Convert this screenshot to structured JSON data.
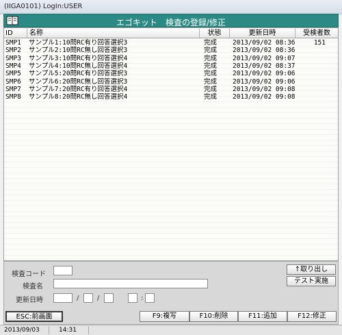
{
  "window": {
    "title": "(IIGA0101)  LogIn:USER"
  },
  "header": {
    "title": "エゴキット　検査の登録/修正",
    "icon": "book-icon"
  },
  "table": {
    "columns": [
      "ID",
      "名称",
      "状態",
      "更新日時",
      "受検者数"
    ],
    "rows": [
      {
        "id": "SMP1",
        "name": "サンプル1:10問RC有り回答選択3",
        "status": "完成",
        "updated": "2013/09/02 08:36",
        "count": "151"
      },
      {
        "id": "SMP2",
        "name": "サンプル2:10問RC無し回答選択3",
        "status": "完成",
        "updated": "2013/09/02 08:36",
        "count": ""
      },
      {
        "id": "SMP3",
        "name": "サンプル3:10問RC有り回答選択4",
        "status": "完成",
        "updated": "2013/09/02 09:07",
        "count": ""
      },
      {
        "id": "SMP4",
        "name": "サンプル4:10問RC無し回答選択4",
        "status": "完成",
        "updated": "2013/09/02 08:37",
        "count": ""
      },
      {
        "id": "SMP5",
        "name": "サンプル5:20問RC有り回答選択3",
        "status": "完成",
        "updated": "2013/09/02 09:06",
        "count": ""
      },
      {
        "id": "SMP6",
        "name": "サンプル6:20問RC無し回答選択3",
        "status": "完成",
        "updated": "2013/09/02 09:06",
        "count": ""
      },
      {
        "id": "SMP7",
        "name": "サンプル7:20問RC有り回答選択4",
        "status": "完成",
        "updated": "2013/09/02 09:08",
        "count": ""
      },
      {
        "id": "SMP8",
        "name": "サンプル8:20問RC無し回答選択4",
        "status": "完成",
        "updated": "2013/09/02 09:08",
        "count": ""
      }
    ]
  },
  "form": {
    "code_label": "検査コード",
    "name_label": "検査名",
    "updated_label": "更新日時",
    "date_sep": "/",
    "time_sep": ":",
    "code_value": "",
    "name_value": ""
  },
  "side_buttons": {
    "retrieve": "↑取り出し",
    "run_test": "テスト実施"
  },
  "function_keys": {
    "esc": "ESC:前画面",
    "f9": "F9:複写",
    "f10": "F10:削除",
    "f11": "F11:追加",
    "f12": "F12:修正"
  },
  "status": {
    "date": "2013/09/03",
    "time": "14:31"
  }
}
